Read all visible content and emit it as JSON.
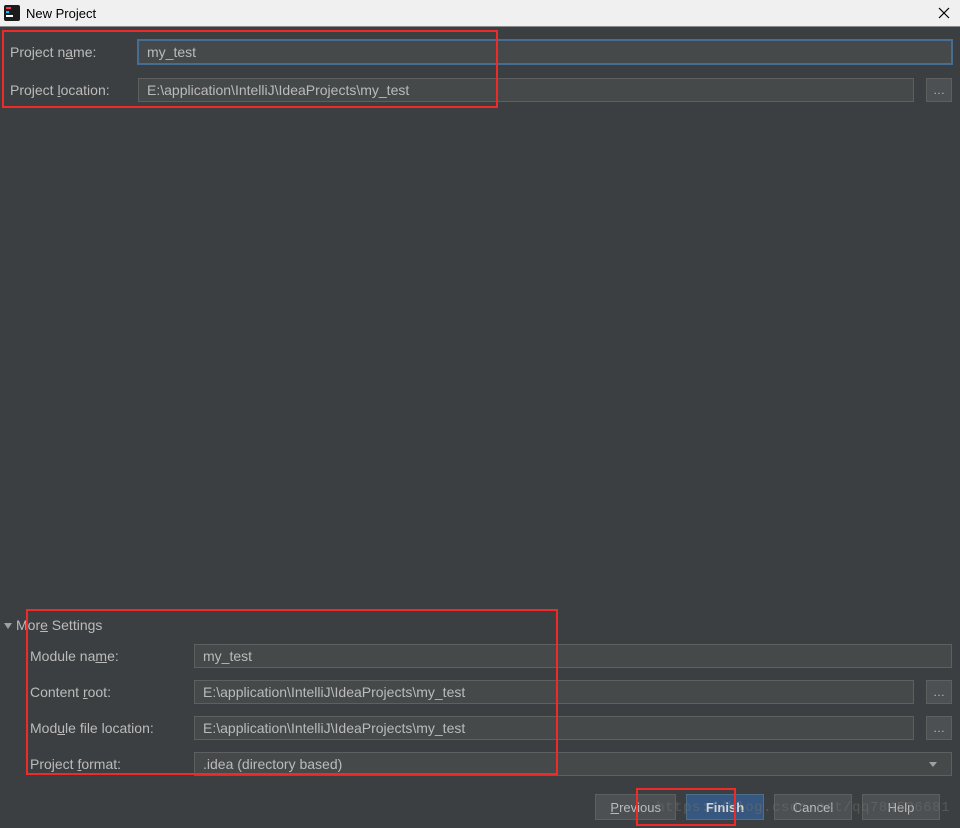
{
  "title": "New Project",
  "top_form": {
    "name_label": "Project name:",
    "name_value": "my_test",
    "location_label": "Project location:",
    "location_value": "E:\\application\\IntelliJ\\IdeaProjects\\my_test"
  },
  "more_header": "More Settings",
  "more": {
    "module_name_label": "Module name:",
    "module_name_value": "my_test",
    "content_root_label": "Content root:",
    "content_root_value": "E:\\application\\IntelliJ\\IdeaProjects\\my_test",
    "module_file_label": "Module file location:",
    "module_file_value": "E:\\application\\IntelliJ\\IdeaProjects\\my_test",
    "project_format_label": "Project format:",
    "project_format_value": ".idea (directory based)"
  },
  "buttons": {
    "previous": "Previous",
    "finish": "Finish",
    "cancel": "Cancel",
    "help": "Help"
  },
  "browse_symbol": "…",
  "watermark": "https://blog.csdn.net/qq784536681"
}
